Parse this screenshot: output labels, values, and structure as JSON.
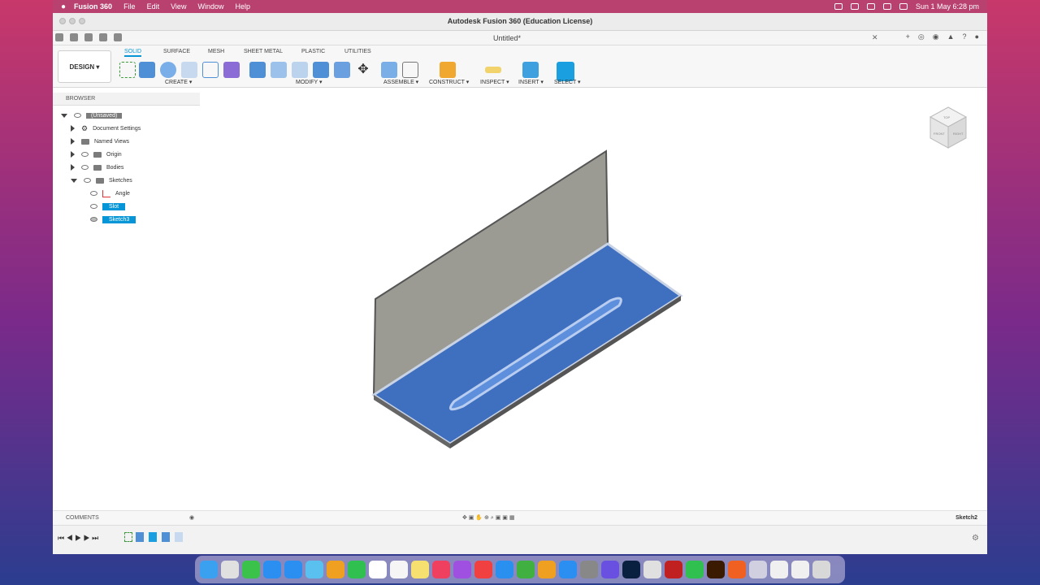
{
  "menubar": {
    "app_name": "Fusion 360",
    "items": [
      "File",
      "Edit",
      "View",
      "Window",
      "Help"
    ],
    "clock": "Sun 1 May  6:28 pm"
  },
  "window": {
    "title": "Autodesk Fusion 360 (Education License)",
    "document_tab": "Untitled*"
  },
  "ribbon": {
    "workspace": "DESIGN ▾",
    "tabs": [
      "SOLID",
      "SURFACE",
      "MESH",
      "SHEET METAL",
      "PLASTIC",
      "UTILITIES"
    ],
    "active_tab": "SOLID",
    "groups": [
      "CREATE ▾",
      "MODIFY ▾",
      "ASSEMBLE ▾",
      "CONSTRUCT ▾",
      "INSPECT ▾",
      "INSERT ▾",
      "SELECT ▾"
    ]
  },
  "browser": {
    "header": "BROWSER",
    "root": "(Unsaved)",
    "items": [
      "Document Settings",
      "Named Views",
      "Origin",
      "Bodies",
      "Sketches"
    ],
    "sketches": [
      "Angle",
      "Slot",
      "Sketch3"
    ]
  },
  "comments": {
    "label": "COMMENTS"
  },
  "status": {
    "active_sketch": "Sketch2"
  },
  "viewcube": {
    "labels": [
      "TOP",
      "FRONT",
      "RIGHT"
    ]
  },
  "colors": {
    "accent": "#0696d7",
    "face_blue": "#3f6fbf",
    "wall_gray": "#9b9b94"
  }
}
